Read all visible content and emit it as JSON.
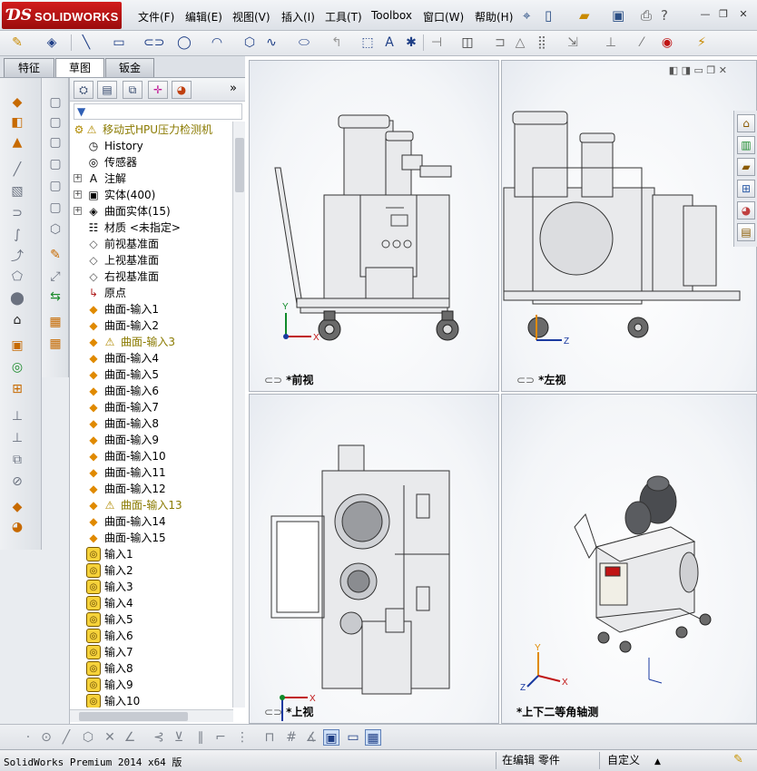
{
  "app": {
    "brand_ds": "ƊS",
    "brand_name": "SOLIDWORKS"
  },
  "menu": {
    "file": "文件(F)",
    "edit": "编辑(E)",
    "view": "视图(V)",
    "insert": "插入(I)",
    "tools": "工具(T)",
    "toolbox": "Toolbox",
    "window": "窗口(W)",
    "help": "帮助(H)"
  },
  "manager_tabs": {
    "feature": "特征",
    "sketch": "草图",
    "sheetmetal": "钣金"
  },
  "tree": {
    "root": "移动式HPU压力检测机",
    "items": [
      {
        "label": "History",
        "icon": "history-icon",
        "expand": ""
      },
      {
        "label": "传感器",
        "icon": "sensor-icon",
        "expand": ""
      },
      {
        "label": "注解",
        "icon": "annotation-icon",
        "expand": "+"
      },
      {
        "label": "实体(400)",
        "icon": "solid-body-folder-icon",
        "expand": "+"
      },
      {
        "label": "曲面实体(15)",
        "icon": "surface-body-folder-icon",
        "expand": "+"
      },
      {
        "label": "材质 <未指定>",
        "icon": "material-icon",
        "expand": ""
      },
      {
        "label": "前视基准面",
        "icon": "plane-icon",
        "expand": ""
      },
      {
        "label": "上视基准面",
        "icon": "plane-icon",
        "expand": ""
      },
      {
        "label": "右视基准面",
        "icon": "plane-icon",
        "expand": ""
      },
      {
        "label": "原点",
        "icon": "origin-icon",
        "expand": ""
      }
    ],
    "surfaces": [
      {
        "label": "曲面-输入1",
        "warn": false
      },
      {
        "label": "曲面-输入2",
        "warn": false
      },
      {
        "label": "曲面-输入3",
        "warn": true
      },
      {
        "label": "曲面-输入4",
        "warn": false
      },
      {
        "label": "曲面-输入5",
        "warn": false
      },
      {
        "label": "曲面-输入6",
        "warn": false
      },
      {
        "label": "曲面-输入7",
        "warn": false
      },
      {
        "label": "曲面-输入8",
        "warn": false
      },
      {
        "label": "曲面-输入9",
        "warn": false
      },
      {
        "label": "曲面-输入10",
        "warn": false
      },
      {
        "label": "曲面-输入11",
        "warn": false
      },
      {
        "label": "曲面-输入12",
        "warn": false
      },
      {
        "label": "曲面-输入13",
        "warn": true
      },
      {
        "label": "曲面-输入14",
        "warn": false
      },
      {
        "label": "曲面-输入15",
        "warn": false
      }
    ],
    "imports": [
      "输入1",
      "输入2",
      "输入3",
      "输入4",
      "输入5",
      "输入6",
      "输入7",
      "输入8",
      "输入9",
      "输入10"
    ]
  },
  "viewports": {
    "front": "*前视",
    "left": "*左视",
    "top": "*上视",
    "iso": "*上下二等角轴测"
  },
  "axes": {
    "x": "X",
    "y": "Y",
    "z": "Z"
  },
  "status": {
    "product": "SolidWorks Premium 2014 x64 版",
    "mode": "在编辑 零件",
    "units": "自定义",
    "units_caret": "▲"
  },
  "colors": {
    "brand_red": "#c01414",
    "surface_orange": "#e08a00",
    "warning_yellow": "#d4a800"
  }
}
